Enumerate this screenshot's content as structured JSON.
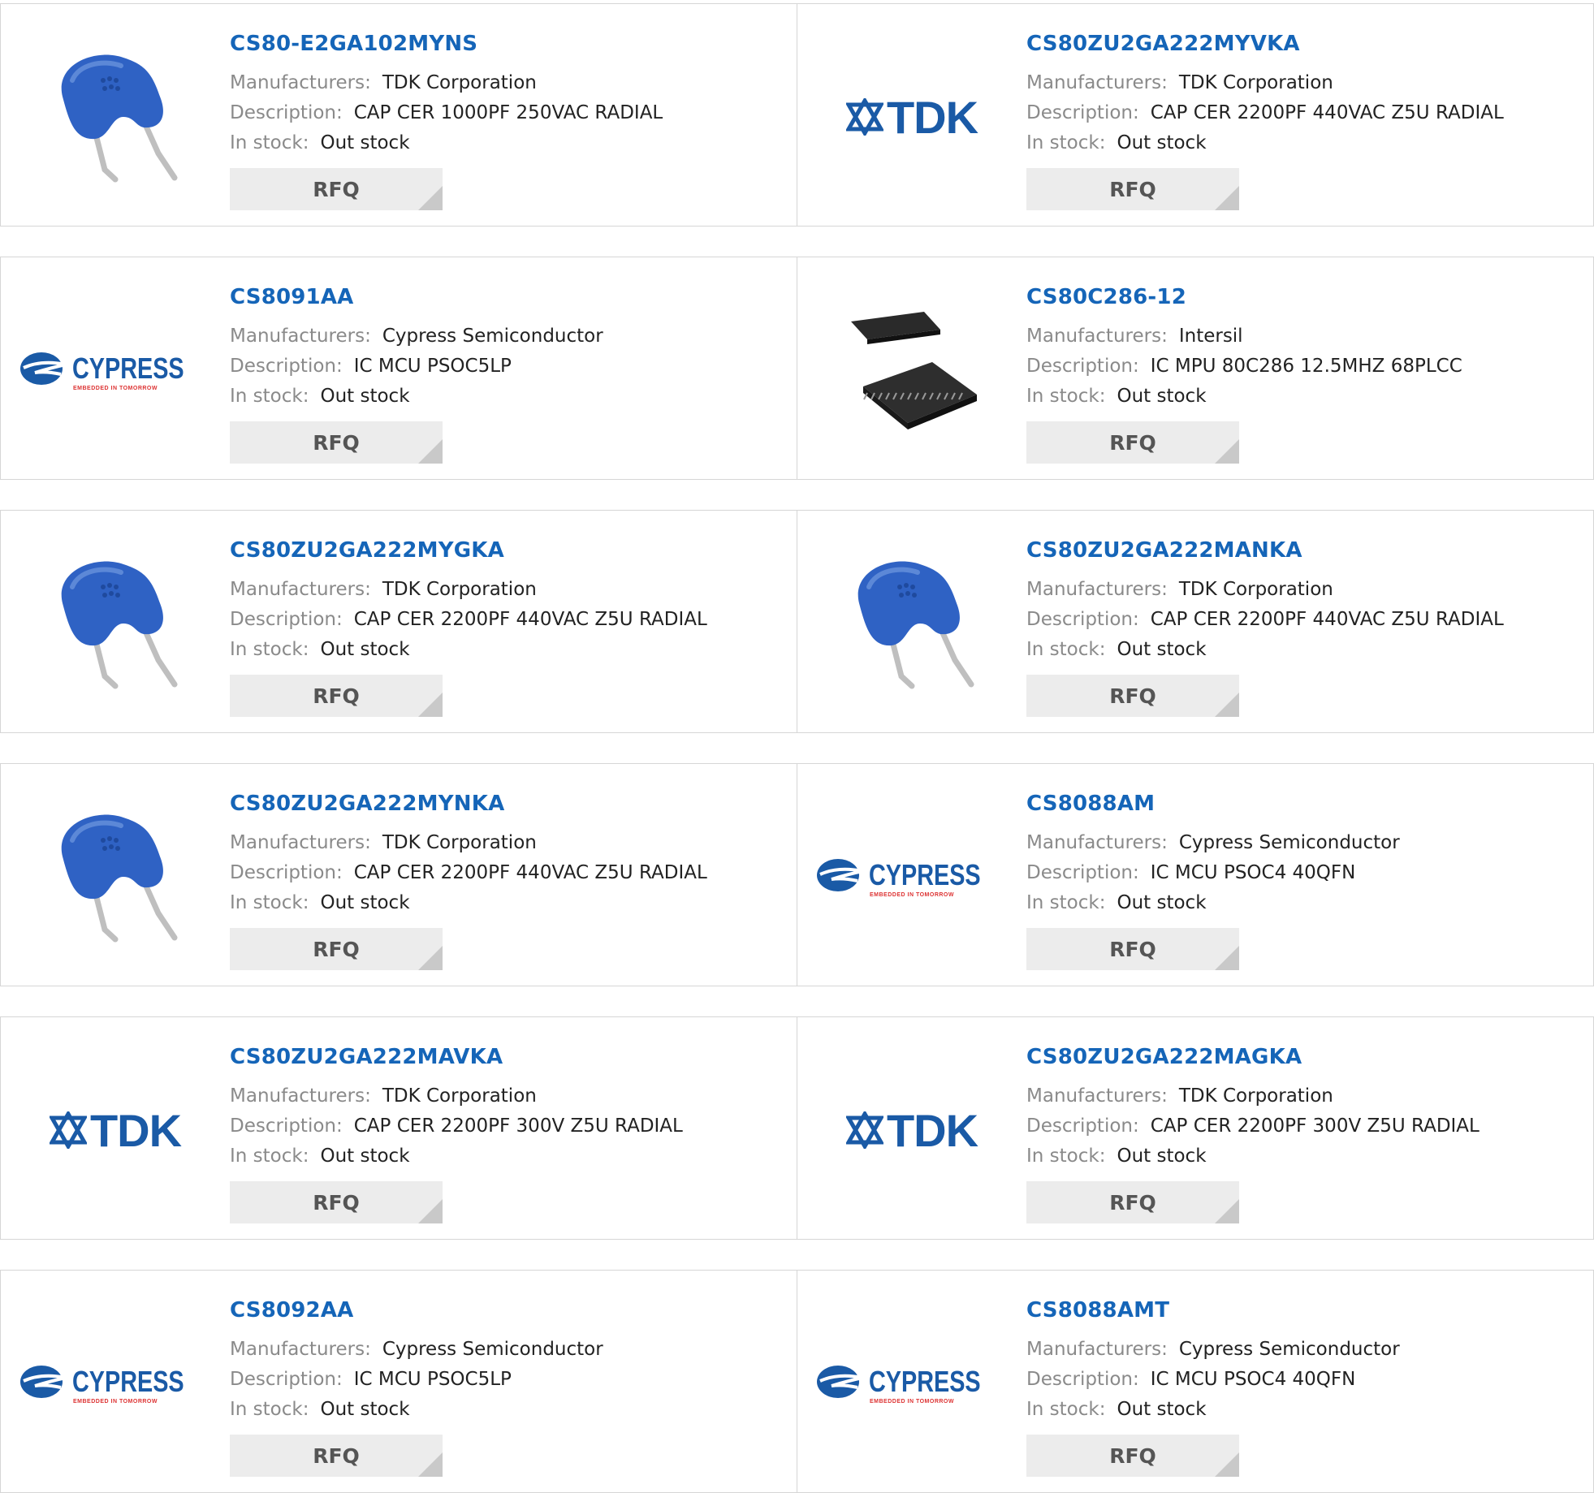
{
  "labels": {
    "manufacturers": "Manufacturers:",
    "description": "Description:",
    "in_stock": "In stock:",
    "rfq": "RFQ"
  },
  "products": [
    {
      "part": "CS80-E2GA102MYNS",
      "manufacturer": "TDK Corporation",
      "description": "CAP CER 1000PF 250VAC RADIAL",
      "stock": "Out stock",
      "image": "capacitor-image"
    },
    {
      "part": "CS80ZU2GA222MYVKA",
      "manufacturer": "TDK Corporation",
      "description": "CAP CER 2200PF 440VAC Z5U RADIAL",
      "stock": "Out stock",
      "image": "tdk-logo"
    },
    {
      "part": "CS8091AA",
      "manufacturer": "Cypress Semiconductor",
      "description": "IC MCU PSOC5LP",
      "stock": "Out stock",
      "image": "cypress-logo"
    },
    {
      "part": "CS80C286-12",
      "manufacturer": "Intersil",
      "description": "IC MPU 80C286 12.5MHZ 68PLCC",
      "stock": "Out stock",
      "image": "plcc-chip-image"
    },
    {
      "part": "CS80ZU2GA222MYGKA",
      "manufacturer": "TDK Corporation",
      "description": "CAP CER 2200PF 440VAC Z5U RADIAL",
      "stock": "Out stock",
      "image": "capacitor-image"
    },
    {
      "part": "CS80ZU2GA222MANKA",
      "manufacturer": "TDK Corporation",
      "description": "CAP CER 2200PF 440VAC Z5U RADIAL",
      "stock": "Out stock",
      "image": "capacitor-image"
    },
    {
      "part": "CS80ZU2GA222MYNKA",
      "manufacturer": "TDK Corporation",
      "description": "CAP CER 2200PF 440VAC Z5U RADIAL",
      "stock": "Out stock",
      "image": "capacitor-image"
    },
    {
      "part": "CS8088AM",
      "manufacturer": "Cypress Semiconductor",
      "description": "IC MCU PSOC4 40QFN",
      "stock": "Out stock",
      "image": "cypress-logo"
    },
    {
      "part": "CS80ZU2GA222MAVKA",
      "manufacturer": "TDK Corporation",
      "description": "CAP CER 2200PF 300V Z5U RADIAL",
      "stock": "Out stock",
      "image": "tdk-logo"
    },
    {
      "part": "CS80ZU2GA222MAGKA",
      "manufacturer": "TDK Corporation",
      "description": "CAP CER 2200PF 300V Z5U RADIAL",
      "stock": "Out stock",
      "image": "tdk-logo"
    },
    {
      "part": "CS8092AA",
      "manufacturer": "Cypress Semiconductor",
      "description": "IC MCU PSOC5LP",
      "stock": "Out stock",
      "image": "cypress-logo"
    },
    {
      "part": "CS8088AMT",
      "manufacturer": "Cypress Semiconductor",
      "description": "IC MCU PSOC4 40QFN",
      "stock": "Out stock",
      "image": "cypress-logo"
    }
  ],
  "logos": {
    "tdk_text": "TDK",
    "cypress_text": "CYPRESS",
    "cypress_tagline": "EMBEDDED IN TOMORROW"
  },
  "colors": {
    "part_link": "#1565b8",
    "label": "#8a8a8a",
    "value": "#222222",
    "rfq_bg": "#ececec",
    "border": "#d6d6d6",
    "capacitor_blue": "#2f62c4"
  }
}
